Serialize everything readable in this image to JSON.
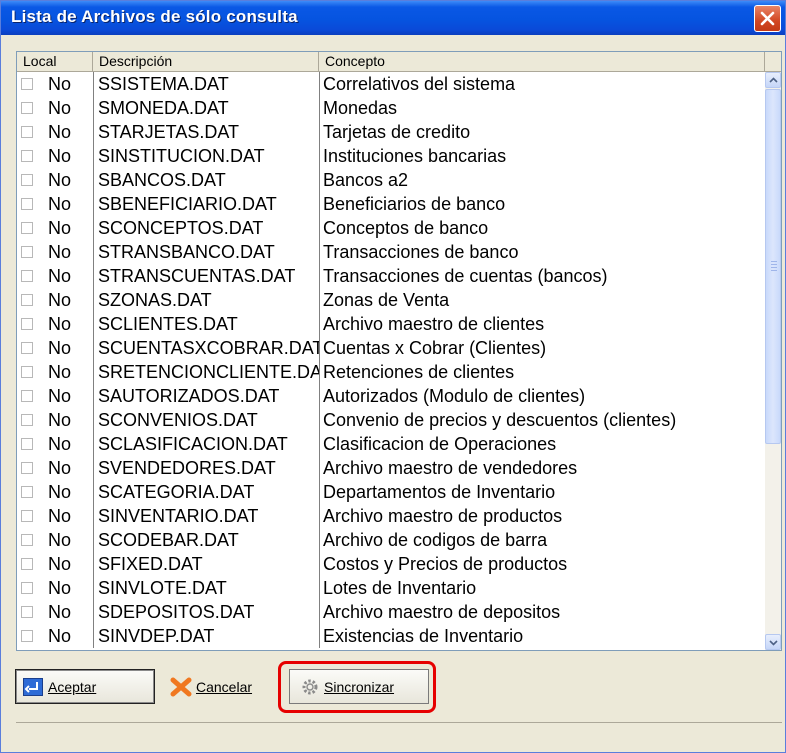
{
  "window": {
    "title": "Lista de Archivos de sólo consulta"
  },
  "columns": {
    "local": "Local",
    "descripcion": "Descripción",
    "concepto": "Concepto"
  },
  "rows": [
    {
      "local": "No",
      "descripcion": "SSISTEMA.DAT",
      "concepto": "Correlativos del sistema"
    },
    {
      "local": "No",
      "descripcion": "SMONEDA.DAT",
      "concepto": "Monedas"
    },
    {
      "local": "No",
      "descripcion": "STARJETAS.DAT",
      "concepto": "Tarjetas de credito"
    },
    {
      "local": "No",
      "descripcion": "SINSTITUCION.DAT",
      "concepto": "Instituciones bancarias"
    },
    {
      "local": "No",
      "descripcion": "SBANCOS.DAT",
      "concepto": "Bancos a2"
    },
    {
      "local": "No",
      "descripcion": "SBENEFICIARIO.DAT",
      "concepto": "Beneficiarios de banco"
    },
    {
      "local": "No",
      "descripcion": "SCONCEPTOS.DAT",
      "concepto": "Conceptos de banco"
    },
    {
      "local": "No",
      "descripcion": "STRANSBANCO.DAT",
      "concepto": "Transacciones de banco"
    },
    {
      "local": "No",
      "descripcion": "STRANSCUENTAS.DAT",
      "concepto": "Transacciones de cuentas (bancos)"
    },
    {
      "local": "No",
      "descripcion": "SZONAS.DAT",
      "concepto": "Zonas de Venta"
    },
    {
      "local": "No",
      "descripcion": "SCLIENTES.DAT",
      "concepto": "Archivo maestro de clientes"
    },
    {
      "local": "No",
      "descripcion": "SCUENTASXCOBRAR.DAT",
      "concepto": "Cuentas x Cobrar (Clientes)"
    },
    {
      "local": "No",
      "descripcion": "SRETENCIONCLIENTE.DAT",
      "concepto": "Retenciones de clientes"
    },
    {
      "local": "No",
      "descripcion": "SAUTORIZADOS.DAT",
      "concepto": "Autorizados (Modulo de clientes)"
    },
    {
      "local": "No",
      "descripcion": "SCONVENIOS.DAT",
      "concepto": "Convenio de precios y descuentos (clientes)"
    },
    {
      "local": "No",
      "descripcion": "SCLASIFICACION.DAT",
      "concepto": "Clasificacion de Operaciones"
    },
    {
      "local": "No",
      "descripcion": "SVENDEDORES.DAT",
      "concepto": "Archivo maestro de vendedores"
    },
    {
      "local": "No",
      "descripcion": "SCATEGORIA.DAT",
      "concepto": "Departamentos de Inventario"
    },
    {
      "local": "No",
      "descripcion": "SINVENTARIO.DAT",
      "concepto": "Archivo maestro de productos"
    },
    {
      "local": "No",
      "descripcion": "SCODEBAR.DAT",
      "concepto": "Archivo de codigos de barra"
    },
    {
      "local": "No",
      "descripcion": "SFIXED.DAT",
      "concepto": "Costos y Precios de productos"
    },
    {
      "local": "No",
      "descripcion": "SINVLOTE.DAT",
      "concepto": "Lotes de Inventario"
    },
    {
      "local": "No",
      "descripcion": "SDEPOSITOS.DAT",
      "concepto": "Archivo maestro de depositos"
    },
    {
      "local": "No",
      "descripcion": "SINVDEP.DAT",
      "concepto": "Existencias de Inventario"
    }
  ],
  "buttons": {
    "aceptar": {
      "label": "Aceptar",
      "icon": "enter-icon"
    },
    "cancelar": {
      "label": "Cancelar",
      "icon": "cancel-x-icon"
    },
    "sincronizar": {
      "label": "Sincronizar",
      "icon": "gear-icon"
    }
  },
  "colors": {
    "titlebar": "#0654E0",
    "highlight": "#E60000",
    "cancel_icon": "#F07820"
  }
}
